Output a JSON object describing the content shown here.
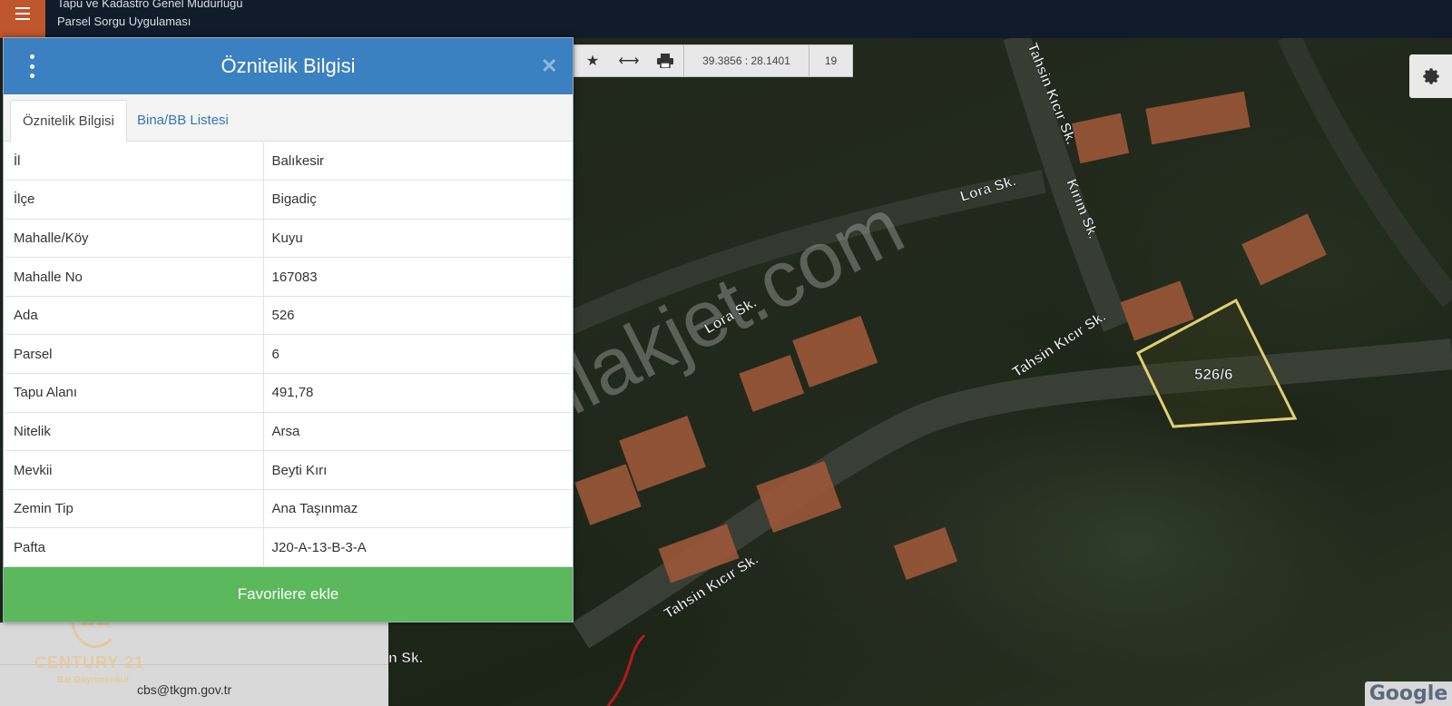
{
  "header": {
    "org_line": "Tapu ve Kadastro Genel Müdürlüğü",
    "app_line": "Parsel Sorgu Uygulaması"
  },
  "popup": {
    "title": "Öznitelik Bilgisi",
    "close_icon": "close-icon",
    "tabs": [
      {
        "label": "Öznitelik Bilgisi",
        "active": true
      },
      {
        "label": "Bina/BB Listesi",
        "active": false
      }
    ],
    "rows": [
      {
        "key": "İl",
        "value": "Balıkesir"
      },
      {
        "key": "İlçe",
        "value": "Bigadiç"
      },
      {
        "key": "Mahalle/Köy",
        "value": "Kuyu"
      },
      {
        "key": "Mahalle No",
        "value": "167083"
      },
      {
        "key": "Ada",
        "value": "526"
      },
      {
        "key": "Parsel",
        "value": "6"
      },
      {
        "key": "Tapu Alanı",
        "value": "491,78"
      },
      {
        "key": "Nitelik",
        "value": "Arsa"
      },
      {
        "key": "Mevkii",
        "value": "Beyti Kırı"
      },
      {
        "key": "Zemin Tip",
        "value": "Ana Taşınmaz"
      },
      {
        "key": "Pafta",
        "value": "J20-A-13-B-3-A"
      }
    ],
    "favorite_button": "Favorilere ekle"
  },
  "toolbar": {
    "coordinates": "39.3856 : 28.1401",
    "zoom": "19"
  },
  "map": {
    "streets": [
      "Tahsin Kıcır Sk.",
      "Kırım Sk.",
      "Lora Sk.",
      "Lora Sk.",
      "Tahsin Kıcır Sk.",
      "Tahsin Kıcır Sk.",
      "n Sk."
    ],
    "parcel_label": "526/6",
    "watermark": "emlakjet.com",
    "attribution": "Google"
  },
  "side_panel": {
    "email": "cbs@tkgm.gov.tr",
    "logo": {
      "mark": "21",
      "name": "CENTURY 21",
      "sub": "Bal Gayrimenkul"
    }
  },
  "colors": {
    "header_blue": "#3b80c0",
    "favorite_green": "#5cb85c",
    "menu_orange": "#c0562c",
    "parcel_outline": "#e0d070"
  }
}
